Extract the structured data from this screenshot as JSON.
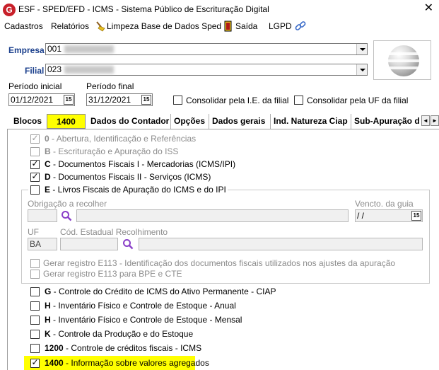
{
  "window": {
    "logo_letter": "G",
    "title": "ESF - SPED/EFD - ICMS - Sistema Público de Escrituração Digital",
    "close_glyph": "✕"
  },
  "menu": {
    "cadastros": "Cadastros",
    "relatorios": "Relatórios",
    "limpeza": "Limpeza Base de Dados Sped",
    "saida": "Saída",
    "lgpd": "LGPD"
  },
  "empresa": {
    "label": "Empresa",
    "value": "001"
  },
  "filial": {
    "label": "Filial",
    "value": "023"
  },
  "periodo_inicial": {
    "label": "Período inicial",
    "value": "01/12/2021",
    "cal_label": "15"
  },
  "periodo_final": {
    "label": "Período final",
    "value": "31/12/2021",
    "cal_label": "15"
  },
  "options": {
    "consolidar_ie": "Consolidar pela I.E. da filial",
    "consolidar_uf": "Consolidar pela UF da filial"
  },
  "tabs": [
    "Blocos",
    "1400",
    "Dados do Contador",
    "Opções",
    "Dados gerais",
    "Ind. Natureza Ciap",
    "Sub-Apuração d"
  ],
  "tab_scroll": {
    "left": "◄",
    "right": "►"
  },
  "blocos": [
    {
      "code": "0",
      "desc": " - Abertura, Identificação e Referências",
      "checked": true,
      "disabled": true
    },
    {
      "code": "B",
      "desc": " - Escrituração e Apuração do ISS",
      "checked": false,
      "disabled": true
    },
    {
      "code": "C",
      "desc": " - Documentos Fiscais I - Mercadorias (ICMS/IPI)",
      "checked": true,
      "disabled": false
    },
    {
      "code": "D",
      "desc": " - Documentos Fiscais II - Serviços (ICMS)",
      "checked": true,
      "disabled": false
    },
    {
      "code": "E",
      "desc": " - Livros Fiscais de Apuração do ICMS e do IPI",
      "checked": false,
      "disabled": false
    }
  ],
  "bloco_e": {
    "obrigacao_label": "Obrigação a recolher",
    "vencto_label": "Vencto. da guia",
    "vencto_value": " / /",
    "cal_label": "15",
    "uf_label": "UF",
    "uf_value": "BA",
    "cod_estadual_label": "Cód. Estadual Recolhimento",
    "gerar_e113": "Gerar registro E113 - Identificação dos documentos fiscais utilizados nos ajustes da apuração",
    "gerar_e113_bpe": "Gerar registro E113 para BPE e CTE"
  },
  "blocos_lower": [
    {
      "code": "G",
      "desc": " - Controle do Crédito de ICMS do Ativo Permanente - CIAP",
      "checked": false
    },
    {
      "code": "H",
      "desc": " - Inventário Físico e Controle de Estoque - Anual",
      "checked": false
    },
    {
      "code": "H",
      "desc": " - Inventário Físico e Controle de Estoque - Mensal",
      "checked": false
    },
    {
      "code": "K",
      "desc": " - Controle da Produção e do Estoque",
      "checked": false
    },
    {
      "code": "1200",
      "desc": " - Controle de créditos fiscais - ICMS",
      "checked": false
    },
    {
      "code": "1400",
      "desc": " - Informação sobre valores agregados",
      "checked": true
    }
  ],
  "colors": {
    "highlight": "#ffff00",
    "label_blue": "#1a3f8c",
    "disabled_gray": "#8c8c8c",
    "search_purple": "#8a3fc8"
  }
}
